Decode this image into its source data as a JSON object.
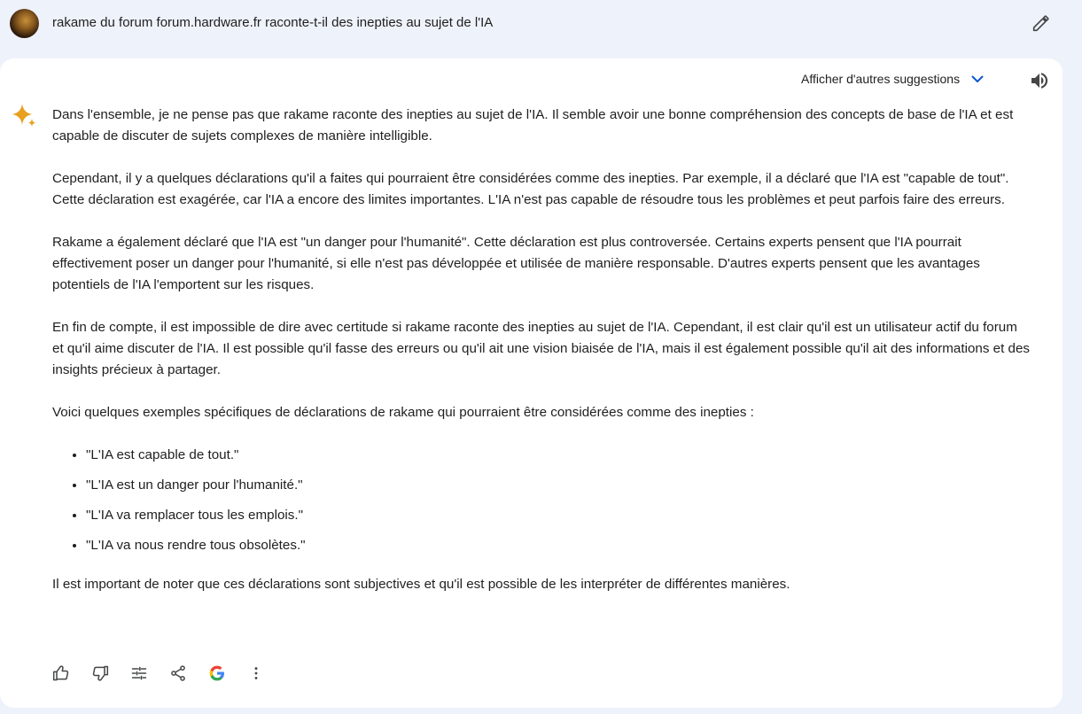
{
  "query": {
    "text": "rakame du forum forum.hardware.fr raconte-t-il des inepties au sujet de l'IA",
    "avatar_icon": "user-avatar",
    "edit_icon": "pencil-icon"
  },
  "response": {
    "other_suggestions_label": "Afficher d'autres suggestions",
    "paragraphs": [
      "Dans l'ensemble, je ne pense pas que rakame raconte des inepties au sujet de l'IA. Il semble avoir une bonne compréhension des concepts de base de l'IA et est capable de discuter de sujets complexes de manière intelligible.",
      "Cependant, il y a quelques déclarations qu'il a faites qui pourraient être considérées comme des inepties. Par exemple, il a déclaré que l'IA est \"capable de tout\". Cette déclaration est exagérée, car l'IA a encore des limites importantes. L'IA n'est pas capable de résoudre tous les problèmes et peut parfois faire des erreurs.",
      "Rakame a également déclaré que l'IA est \"un danger pour l'humanité\". Cette déclaration est plus controversée. Certains experts pensent que l'IA pourrait effectivement poser un danger pour l'humanité, si elle n'est pas développée et utilisée de manière responsable. D'autres experts pensent que les avantages potentiels de l'IA l'emportent sur les risques.",
      "En fin de compte, il est impossible de dire avec certitude si rakame raconte des inepties au sujet de l'IA. Cependant, il est clair qu'il est un utilisateur actif du forum et qu'il aime discuter de l'IA. Il est possible qu'il fasse des erreurs ou qu'il ait une vision biaisée de l'IA, mais il est également possible qu'il ait des informations et des insights précieux à partager.",
      "Voici quelques exemples spécifiques de déclarations de rakame qui pourraient être considérées comme des inepties :"
    ],
    "list_items": [
      "\"L'IA est capable de tout.\"",
      "\"L'IA est un danger pour l'humanité.\"",
      "\"L'IA va remplacer tous les emplois.\"",
      "\"L'IA va nous rendre tous obsolètes.\""
    ],
    "closing": "Il est important de noter que ces déclarations sont subjectives et qu'il est possible de les interpréter de différentes manières."
  },
  "actions": [
    "thumbs-up-icon",
    "thumbs-down-icon",
    "modify-response-icon",
    "share-icon",
    "google-icon",
    "more-vert-icon"
  ],
  "colors": {
    "background": "#eef2fa",
    "card": "#ffffff",
    "accent_blue": "#0b57d0",
    "sparkle": "#e8a020"
  }
}
